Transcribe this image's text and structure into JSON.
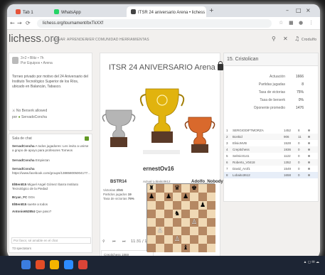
{
  "browser": {
    "tabs": [
      {
        "label": "Tab 1",
        "color": "#e6543a"
      },
      {
        "label": "WhatsApp",
        "color": "#25d366"
      },
      {
        "label": "ITSR 24 aniversario Arena • lichess",
        "color": "#444444"
      }
    ],
    "new_tab": "+",
    "url": "lichess.org/tournament/bxTkXXf"
  },
  "site": {
    "logo_main": "lichess",
    "logo_org": ".org",
    "nav": [
      "JUGAR",
      "APRENDER",
      "VER",
      "COMUNIDAD",
      "HERRAMIENTAS"
    ],
    "user": "Crodulfo"
  },
  "tournament_info": {
    "meta_line1": "3+2 • Blitz • 7h",
    "meta_line2": "Por Equipos • Arena",
    "description": "Torneo privado por motivo del 24 Aniversario del Instituto Tecnológico Superior de los Ríos, ubicado en Balancán, Tabasco.",
    "berserk": "No Berserk allowed",
    "by_label": "por",
    "creator": "ServadoConcha"
  },
  "chat": {
    "title": "Sala de chat",
    "messages": [
      {
        "user": "ServadConcha",
        "text": "A todos jugadores: Les invito a unirse a grupo de apoyo para profesores Torneos"
      },
      {
        "user": "ServadConcha",
        "text": "Empiezan"
      },
      {
        "user": "ServadConcha",
        "text": "https://www.facebook.com/groups/138858005004177..."
      },
      {
        "user": "ElBen815",
        "text": "Miguel Angel Gómez Ibarra Instituto Tecnológico de la Piedad"
      },
      {
        "user": "Bryan_FC",
        "text": "GGs"
      },
      {
        "user": "ElBen815",
        "text": "suerte a todos"
      },
      {
        "user": "Antonio652854",
        "text": "Que paso?"
      }
    ],
    "input_placeholder": "Por favor, sé amable en el chat",
    "spectators": "73 spectators"
  },
  "arena": {
    "title": "ITSR 24 ANIVERSARIO Arena",
    "podium": [
      {
        "name": "BSTR14",
        "label_a": "Victorias",
        "val_a": "2/5G",
        "label_b": "Partidos jugados",
        "val_b": "19",
        "label_c": "Tasa de victorias",
        "val_c": "75%"
      },
      {
        "name": "ernestOv16"
      },
      {
        "name": "Adolfo_Nobody"
      }
    ],
    "game_label": "Actual",
    "game_player": "Lobaito3612",
    "game_time": "11:31 / 10",
    "players_strip": [
      {
        "name": "Crepitchess",
        "rating": "1869"
      },
      {
        "name": "AnthyCorbalan",
        "rating": "1493"
      }
    ]
  },
  "standings": {
    "title": "15. Cristolican",
    "stats": [
      {
        "label": "Actuación",
        "value": "1666"
      },
      {
        "label": "Partidas jugadas",
        "value": "8"
      },
      {
        "label": "Tasa de victorias",
        "value": "75%"
      },
      {
        "label": "Tasa de berserk",
        "value": "0%"
      },
      {
        "label": "Oponente promedio",
        "value": "1476"
      }
    ],
    "rows": [
      {
        "rank": "1",
        "name": "SERGIODIFTMORZA",
        "rating": "1452",
        "score": "8"
      },
      {
        "rank": "2",
        "name": "Bonkid",
        "rating": "906",
        "score": "11"
      },
      {
        "rank": "3",
        "name": "ElisioNVB",
        "rating": "1528",
        "score": "0"
      },
      {
        "rank": "4",
        "name": "Crepitchess",
        "rating": "1936",
        "score": "0"
      },
      {
        "rank": "5",
        "name": "Selmic0141",
        "rating": "1122",
        "score": "0"
      },
      {
        "rank": "6",
        "name": "Roberto_V0418",
        "rating": "1352",
        "score": "0"
      },
      {
        "rank": "7",
        "name": "David_Arof1",
        "rating": "1549",
        "score": "0"
      },
      {
        "rank": "8",
        "name": "Lobaito3612",
        "rating": "1658",
        "score": "0"
      }
    ]
  },
  "hint": "▲ picture over AVE",
  "colors": {
    "accent": "#629924",
    "gold": "#e1b30e",
    "bronze": "#d9692c",
    "silver": "#a5a5a5"
  }
}
